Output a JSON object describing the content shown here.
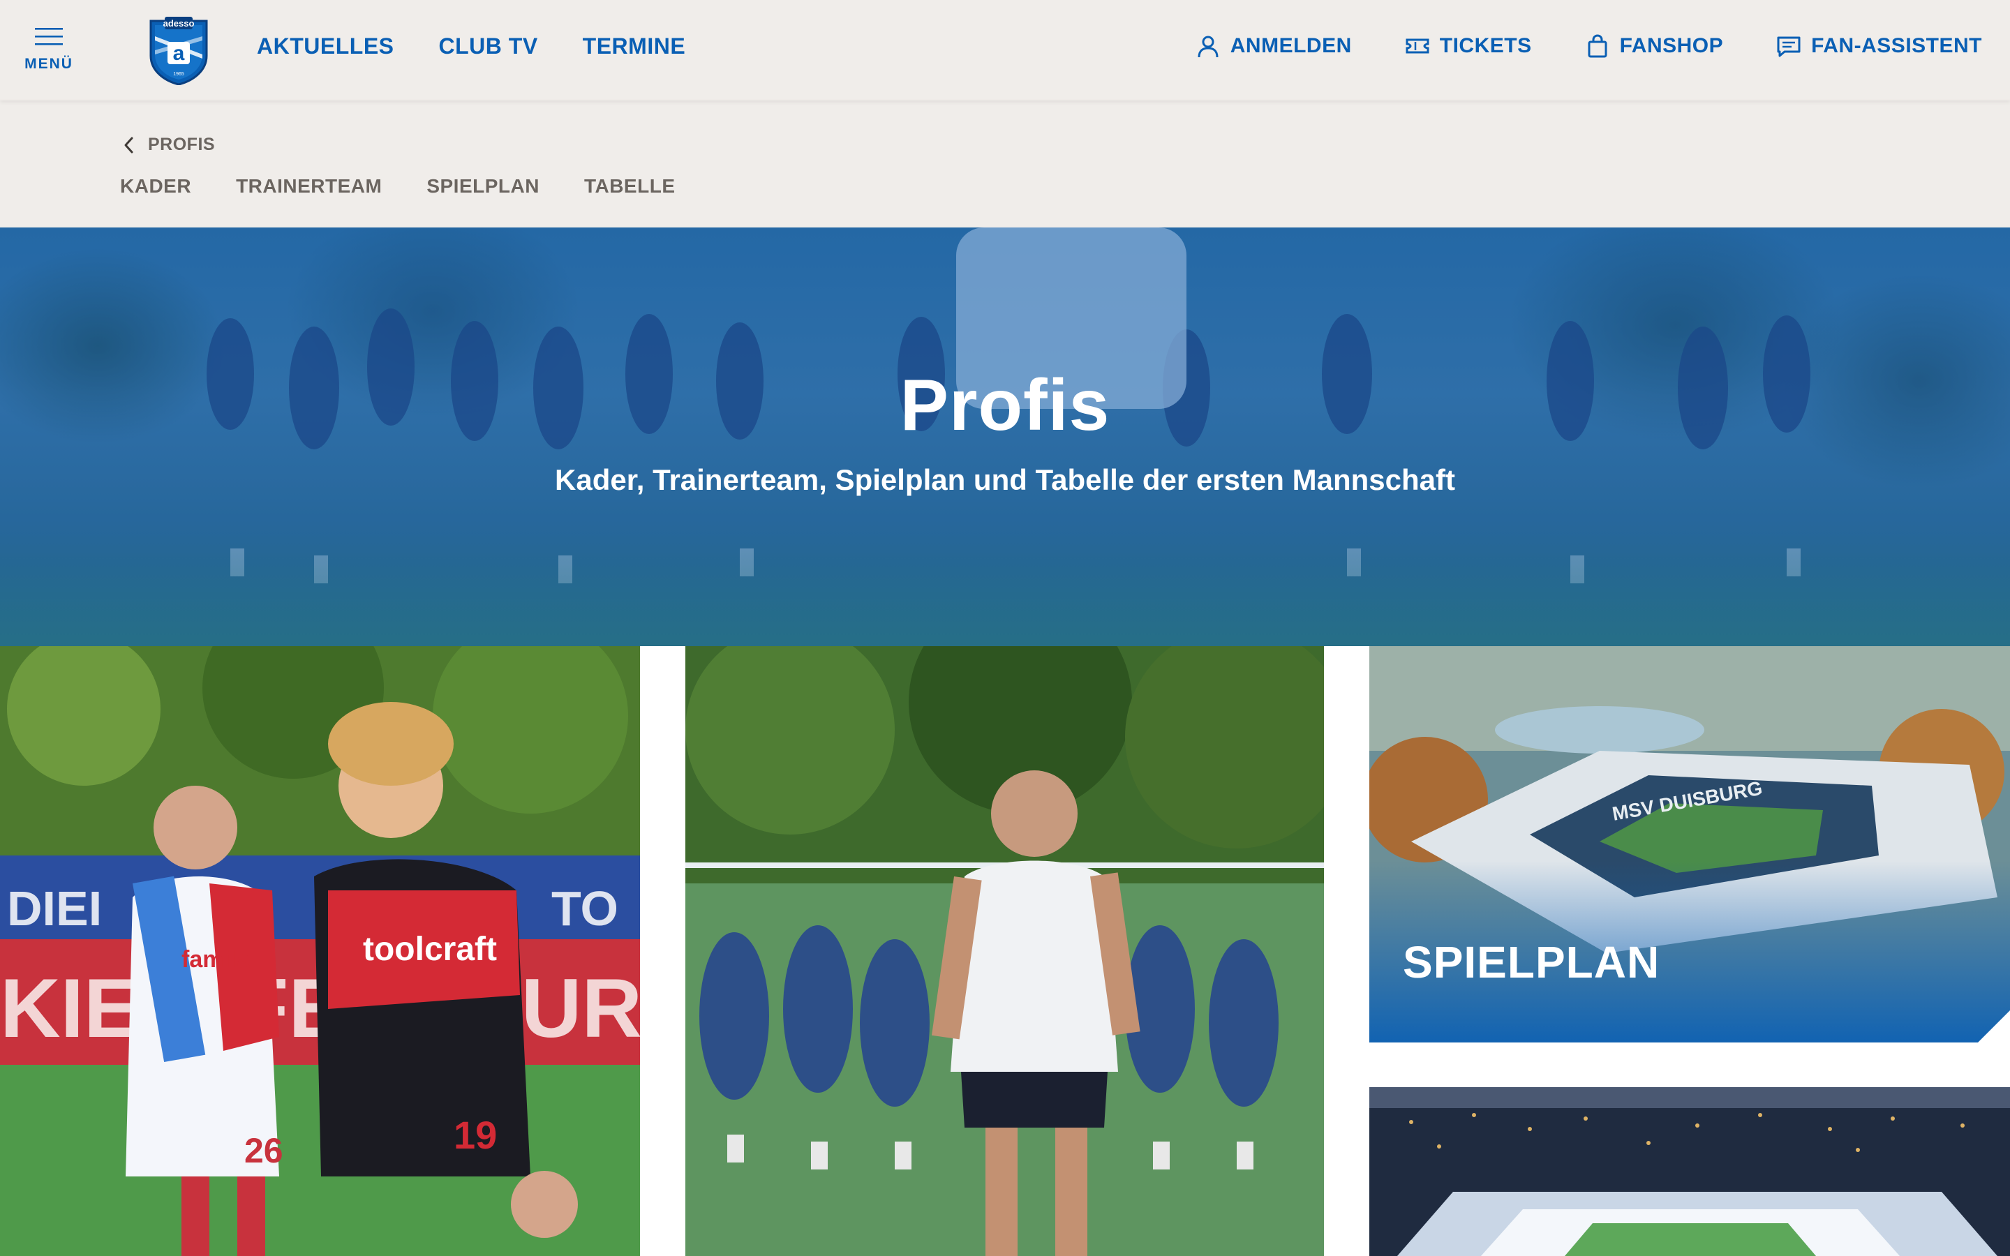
{
  "header": {
    "menu_label": "MENÜ",
    "logo_text": "adesso",
    "logo_letter": "a",
    "logo_year": "1965",
    "nav": [
      "AKTUELLES",
      "CLUB TV",
      "TERMINE"
    ],
    "util": [
      {
        "label": "ANMELDEN",
        "icon": "user-icon"
      },
      {
        "label": "TICKETS",
        "icon": "ticket-icon"
      },
      {
        "label": "FANSHOP",
        "icon": "shopping-bag-icon"
      },
      {
        "label": "FAN-ASSISTENT",
        "icon": "chat-icon"
      }
    ]
  },
  "subnav": {
    "back_label": "PROFIS",
    "tabs": [
      "KADER",
      "TRAINERTEAM",
      "SPIELPLAN",
      "TABELLE"
    ]
  },
  "hero": {
    "title": "Profis",
    "subtitle": "Kader, Trainerteam, Spielplan und Tabelle der ersten Mannschaft"
  },
  "cards": {
    "spielplan": "SPIELPLAN"
  },
  "photo_text": {
    "board_left": "DIEI",
    "board_right": "TO",
    "board_bottom": "KIEL, FENSBURG",
    "sponsor_left": "famila",
    "sponsor_right": "toolcraft",
    "number_left": "26",
    "number_right": "19",
    "stadium_roof": "MSV DUISBURG"
  },
  "colors": {
    "brand_blue": "#0a5fb4",
    "header_bg": "#f0edea",
    "muted_text": "#6b6560"
  }
}
